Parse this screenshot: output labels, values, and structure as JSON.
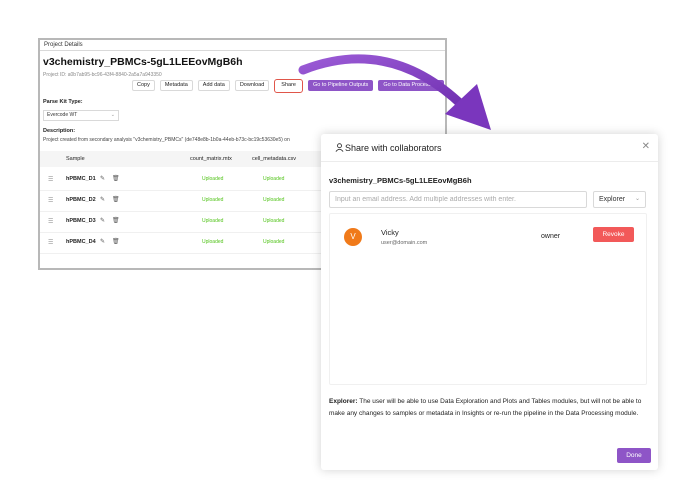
{
  "project_panel": {
    "header": "Project Details",
    "title": "v3chemistry_PBMCs-5gL1LEEovMgB6h",
    "project_id": "Project ID: a0b7ab95-bc96-43f4-8840-2a5a7a943350",
    "toolbar": {
      "copy": "Copy",
      "metadata": "Metadata",
      "add_data": "Add data",
      "download": "Download",
      "share": "Share",
      "pipeline_outputs": "Go to Pipeline Outputs",
      "data_processing": "Go to Data Processing"
    },
    "parse_kit_label": "Parse Kit Type:",
    "parse_kit_value": "Evercode WT",
    "description_label": "Description:",
    "description_text": "Project created from secondary analysis \"v3chemistry_PBMCs\" (de748e8b-1b0a-44eb-b73c-bc19c53630e5) on",
    "table": {
      "headers": [
        "Sample",
        "count_matrix.mtx",
        "cell_metadata.csv"
      ],
      "rows": [
        {
          "sample": "hPBMC_D1",
          "count_status": "Uploaded",
          "meta_status": "Uploaded"
        },
        {
          "sample": "hPBMC_D2",
          "count_status": "Uploaded",
          "meta_status": "Uploaded"
        },
        {
          "sample": "hPBMC_D3",
          "count_status": "Uploaded",
          "meta_status": "Uploaded"
        },
        {
          "sample": "hPBMC_D4",
          "count_status": "Uploaded",
          "meta_status": "Uploaded"
        }
      ]
    }
  },
  "modal": {
    "title": "Share with collaborators",
    "project_name": "v3chemistry_PBMCs-5gL1LEEovMgB6h",
    "email_placeholder": "Input an email address. Add multiple addresses with enter.",
    "role_value": "Explorer",
    "collaborators": [
      {
        "initial": "V",
        "name": "Vicky",
        "email": "user@domain.com",
        "role": "owner",
        "action": "Revoke"
      }
    ],
    "explainer_bold": "Explorer:",
    "explainer_text": " The user will be able to use Data Exploration and Plots and Tables modules, but will not be able to make any changes to samples or metadata in Insights or re-run the pipeline in the Data Processing module.",
    "done_label": "Done"
  },
  "colors": {
    "accent_purple": "#8e55c7",
    "revoke_red": "#f25959",
    "avatar_orange": "#f07a1a",
    "status_green": "#52c41a",
    "arrow_purple": "#8a45c9"
  }
}
